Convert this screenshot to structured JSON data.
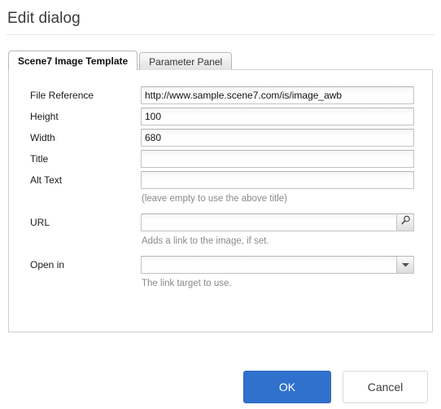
{
  "dialog": {
    "title": "Edit dialog"
  },
  "tabs": [
    {
      "label": "Scene7 Image Template",
      "active": true
    },
    {
      "label": "Parameter Panel",
      "active": false
    }
  ],
  "form": {
    "fields": [
      {
        "label": "File Reference",
        "value": "http://www.sample.scene7.com/is/image_awb",
        "placeholder": "",
        "type": "text",
        "hint": ""
      },
      {
        "label": "Height",
        "value": "100",
        "placeholder": "",
        "type": "text",
        "hint": ""
      },
      {
        "label": "Width",
        "value": "680",
        "placeholder": "",
        "type": "text",
        "hint": ""
      },
      {
        "label": "Title",
        "value": "",
        "placeholder": "",
        "type": "text",
        "hint": ""
      },
      {
        "label": "Alt Text",
        "value": "",
        "placeholder": "",
        "type": "text",
        "hint": "(leave empty to use the above title)"
      },
      {
        "label": "URL",
        "value": "",
        "placeholder": "",
        "type": "text-with-picker",
        "picker_icon": "search-icon",
        "hint": "Adds a link to the image, if set."
      },
      {
        "label": "Open in",
        "value": "",
        "placeholder": "",
        "type": "select",
        "dropdown_icon": "chevron-down-icon",
        "hint": "The link target to use."
      }
    ]
  },
  "footer": {
    "ok_label": "OK",
    "cancel_label": "Cancel"
  },
  "colors": {
    "accent": "#3071ce",
    "panel_border": "#cfcfcf",
    "hint_text": "#8a8a8a"
  }
}
